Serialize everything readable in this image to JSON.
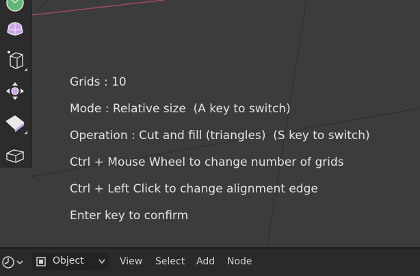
{
  "overlay": {
    "lines": [
      "Grids : 10",
      "Mode : Relative size  (A key to switch)",
      "Operation : Cut and fill (triangles)  (S key to switch)",
      "Ctrl + Mouse Wheel to change number of grids",
      "Ctrl + Left Click to change alignment edge",
      "Enter key to confirm"
    ]
  },
  "bottombar": {
    "mode_label": "Object",
    "menus": [
      "View",
      "Select",
      "Add",
      "Node"
    ]
  },
  "toolbar": {
    "tools": [
      "circle-tool-icon",
      "sphere-tool-icon",
      "cube-tool-icon",
      "transform-tool-icon",
      "bevel-tool-icon",
      "box-tool-icon"
    ]
  },
  "colors": {
    "viewport_bg": "#3c3c3c",
    "toolbar_bg": "#2c2c2c",
    "accent_pink": "#c9a6e8",
    "axis_red": "#a24a5e",
    "text": "#e3e3e3"
  }
}
